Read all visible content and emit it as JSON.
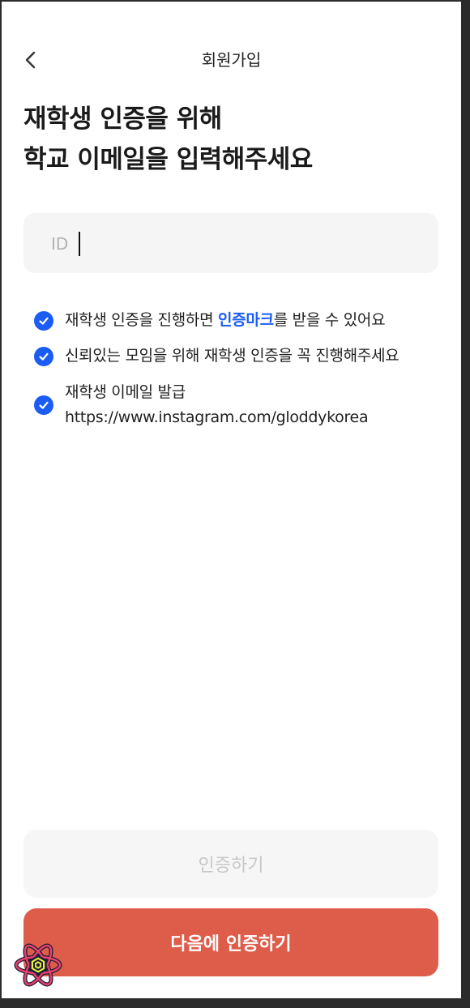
{
  "header": {
    "title": "회원가입"
  },
  "headline": {
    "line1": "재학생 인증을 위해",
    "line2": "학교 이메일을 입력해주세요"
  },
  "id_field": {
    "label": "ID",
    "value": ""
  },
  "notices": [
    {
      "before": "재학생 인증을 진행하면 ",
      "highlight": "인증마크",
      "after": "를 받을 수 있어요"
    },
    {
      "text": "신뢰있는 모임을 위해 재학생 인증을 꼭 진행해주세요"
    },
    {
      "line1": "재학생 이메일 발급",
      "line2": "https://www.instagram.com/gloddykorea"
    }
  ],
  "buttons": {
    "verify": "인증하기",
    "later": "다음에 인증하기"
  },
  "colors": {
    "accent": "#1b5cf5",
    "primary_button": "#de5d4a",
    "disabled_button": "#f6f6f6"
  }
}
